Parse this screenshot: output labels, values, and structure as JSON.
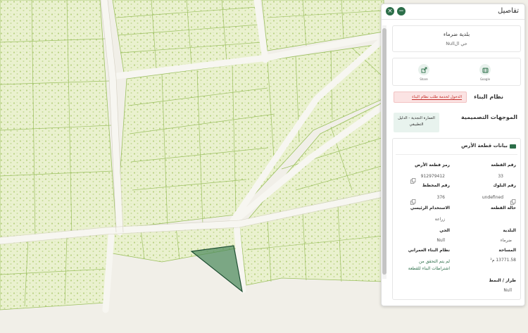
{
  "panel": {
    "title": "تفاصيل",
    "close_glyph": "×",
    "minimize_glyph": "−"
  },
  "municipality": {
    "name": "بلدية ضرماء",
    "district": "حي الNull"
  },
  "share": {
    "google_label": "Google",
    "other_label": "Share"
  },
  "building_system": {
    "title": "نظام البناء",
    "link_text": "الدخول لخدمة طلب نظام البناء"
  },
  "guidelines": {
    "title": "الموجهات التصميمية",
    "chip": "العمارة النجدية - الدليل التطبيقي"
  },
  "land_data": {
    "title": "بيانات قطعة الأرض",
    "fields": {
      "parcel_number_label": "رقم القطعة",
      "parcel_number_value": "33",
      "land_code_label": "رمز قطعة الأرض",
      "land_code_value": "912979412",
      "block_number_label": "رقم البلوك",
      "block_number_value": "undefined",
      "plan_number_label": "رقم المخطط",
      "plan_number_value": "376",
      "parcel_status_label": "حالة القطعة",
      "main_use_label": "الاستخدام الرئيسي",
      "main_use_value": "زراعة",
      "municipality_label": "البلدية",
      "municipality_value": "ضرماء",
      "district_label": "الحي",
      "district_value": "Null",
      "area_label": "المساحة",
      "area_value": "13771.58 م²",
      "urban_code_label": "نظام البناء العمراني",
      "urban_code_value": "لم يتم التحقق من اشتراطات البناء للقطعة",
      "style_label": "طراز / النمط",
      "style_value": "Null"
    }
  },
  "colors": {
    "brand_green": "#2c6e49",
    "selected_parcel": "#4e8a5d",
    "alert_red": "#c4302b"
  }
}
